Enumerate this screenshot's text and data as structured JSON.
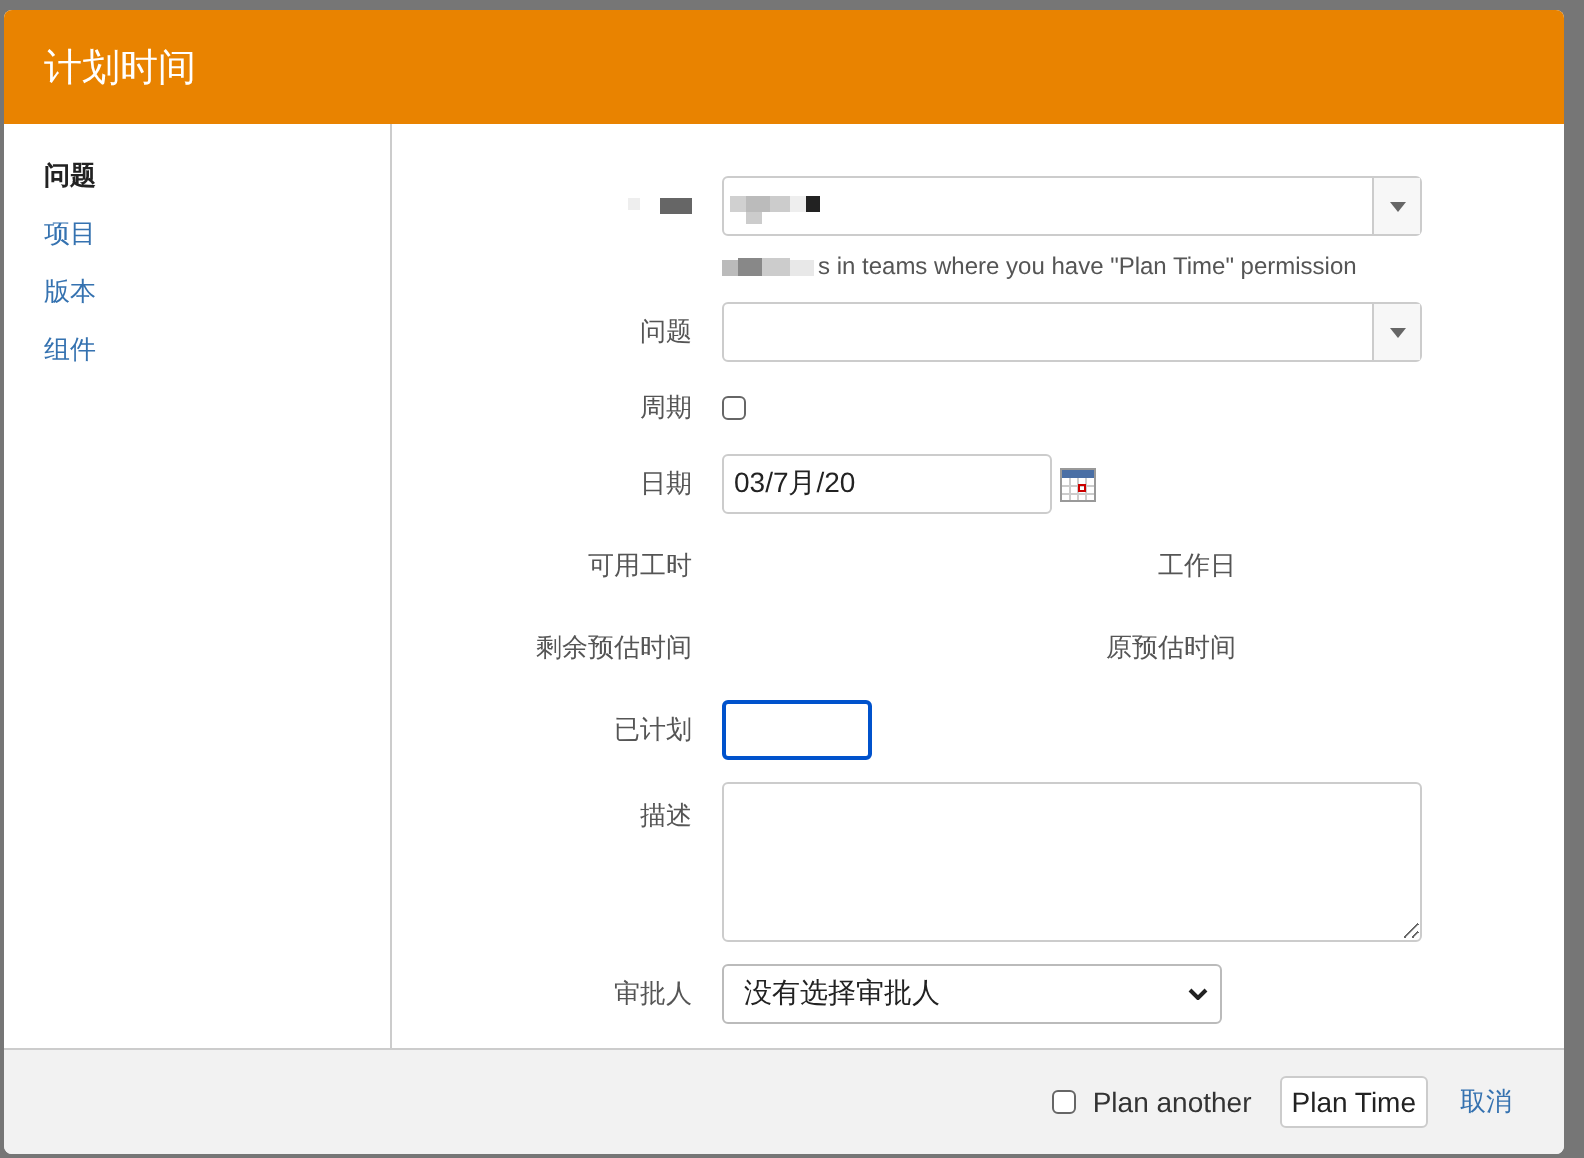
{
  "dialog": {
    "title": "计划时间"
  },
  "sidebar": {
    "items": [
      {
        "label": "问题",
        "selected": true
      },
      {
        "label": "项目",
        "selected": false
      },
      {
        "label": "版本",
        "selected": false
      },
      {
        "label": "组件",
        "selected": false
      }
    ]
  },
  "form": {
    "rows": [
      {
        "kind": "redacted-select",
        "hint": "s in teams where you have \"Plan Time\" permission"
      },
      {
        "kind": "select",
        "label": "问题"
      },
      {
        "kind": "checkbox",
        "label": "周期",
        "checked": false
      },
      {
        "kind": "date",
        "label": "日期",
        "value": "03/7月/20"
      },
      {
        "kind": "info",
        "label": "可用工时",
        "right_label": "工作日"
      },
      {
        "kind": "info",
        "label": "剩余预估时间",
        "right_label": "原预估时间"
      },
      {
        "kind": "input",
        "label": "已计划",
        "focused": true
      },
      {
        "kind": "textarea",
        "label": "描述"
      },
      {
        "kind": "dropdown",
        "label": "审批人",
        "value": "没有选择审批人"
      }
    ]
  },
  "footer": {
    "plan_another": {
      "label": "Plan another",
      "checked": false
    },
    "submit": "Plan Time",
    "cancel": "取消"
  }
}
